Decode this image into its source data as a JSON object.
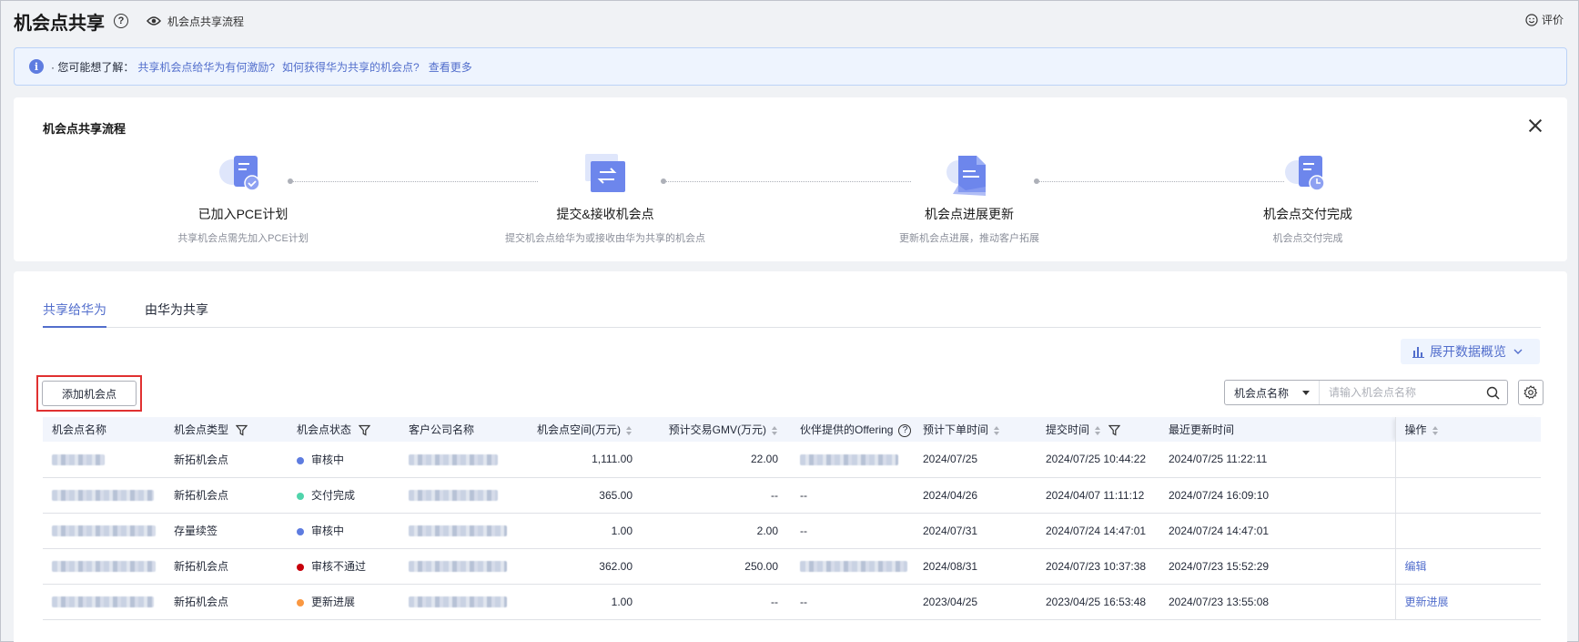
{
  "header": {
    "title": "机会点共享",
    "flow_link": "机会点共享流程",
    "rate": "评价"
  },
  "info": {
    "prefix": "· 您可能想了解：",
    "link1": "共享机会点给华为有何激励?",
    "link2": "如何获得华为共享的机会点?",
    "more": "查看更多"
  },
  "flow": {
    "title": "机会点共享流程",
    "steps": [
      {
        "name": "已加入PCE计划",
        "desc": "共享机会点需先加入PCE计划"
      },
      {
        "name": "提交&接收机会点",
        "desc": "提交机会点给华为或接收由华为共享的机会点"
      },
      {
        "name": "机会点进展更新",
        "desc": "更新机会点进展，推动客户拓展"
      },
      {
        "name": "机会点交付完成",
        "desc": "机会点交付完成"
      }
    ]
  },
  "tabs": [
    {
      "label": "共享给华为",
      "active": true
    },
    {
      "label": "由华为共享",
      "active": false
    }
  ],
  "toolbar": {
    "overview": "展开数据概览",
    "add": "添加机会点",
    "search_field": "机会点名称",
    "search_placeholder": "请输入机会点名称"
  },
  "table": {
    "columns": [
      "机会点名称",
      "机会点类型",
      "机会点状态",
      "客户公司名称",
      "机会点空间(万元)",
      "预计交易GMV(万元)",
      "伙伴提供的Offering",
      "预计下单时间",
      "提交时间",
      "最近更新时间",
      "操作"
    ],
    "rows": [
      {
        "type": "新拓机会点",
        "status": "审核中",
        "status_color": "#5e7ce0",
        "space": "1,111.00",
        "gmv": "22.00",
        "offering": "",
        "order": "2024/07/25",
        "submit": "2024/07/25 10:44:22",
        "update": "2024/07/25 11:22:11",
        "op": ""
      },
      {
        "type": "新拓机会点",
        "status": "交付完成",
        "status_color": "#50d4ab",
        "space": "365.00",
        "gmv": "--",
        "offering": "--",
        "order": "2024/04/26",
        "submit": "2024/04/07 11:11:12",
        "update": "2024/07/24 16:09:10",
        "op": ""
      },
      {
        "type": "存量续签",
        "status": "审核中",
        "status_color": "#5e7ce0",
        "space": "1.00",
        "gmv": "2.00",
        "offering": "--",
        "order": "2024/07/31",
        "submit": "2024/07/24 14:47:01",
        "update": "2024/07/24 14:47:01",
        "op": ""
      },
      {
        "type": "新拓机会点",
        "status": "审核不通过",
        "status_color": "#c7000b",
        "space": "362.00",
        "gmv": "250.00",
        "offering": "",
        "order": "2024/08/31",
        "submit": "2024/07/23 10:37:38",
        "update": "2024/07/23 15:52:29",
        "op": "编辑"
      },
      {
        "type": "新拓机会点",
        "status": "更新进展",
        "status_color": "#fa9841",
        "space": "1.00",
        "gmv": "--",
        "offering": "--",
        "order": "2023/04/25",
        "submit": "2023/04/25 16:53:48",
        "update": "2024/07/23 13:55:08",
        "op": "更新进展"
      }
    ]
  }
}
